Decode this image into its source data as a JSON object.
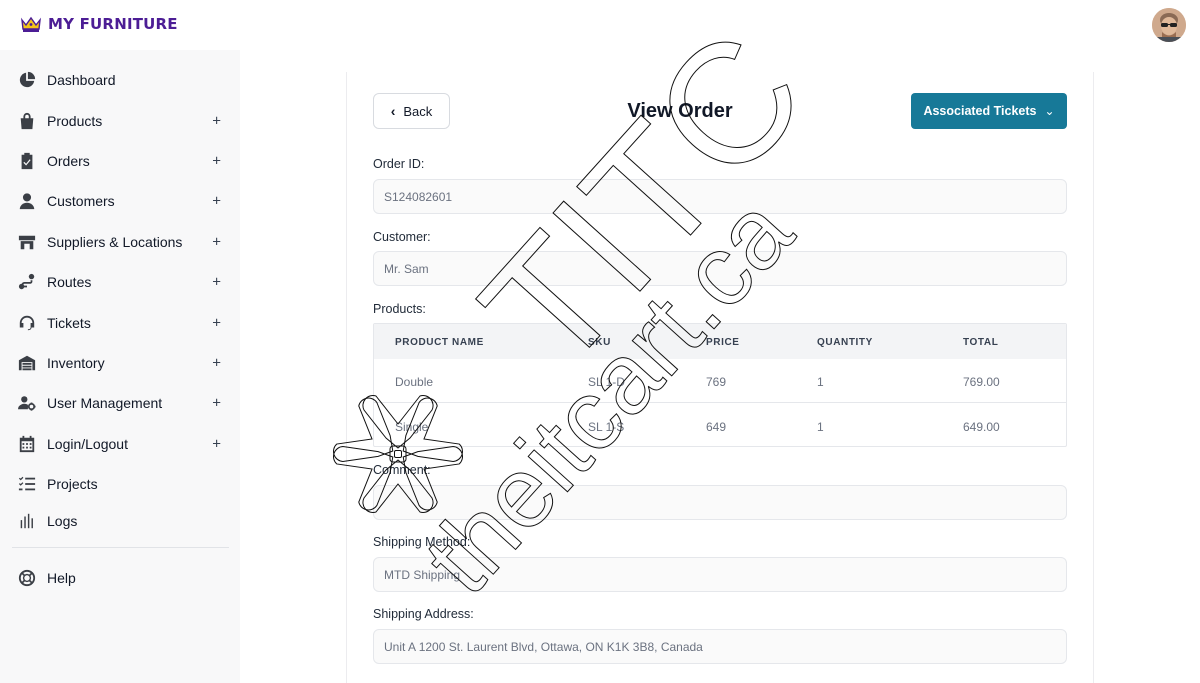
{
  "header": {
    "brand": "MY FURNITURE",
    "accent_color": "#4c1d95",
    "avatar": "user-avatar"
  },
  "sidebar": {
    "items": [
      {
        "label": "Dashboard",
        "icon": "pie-chart-icon",
        "expandable": false
      },
      {
        "label": "Products",
        "icon": "shopping-bag-icon",
        "expandable": true
      },
      {
        "label": "Orders",
        "icon": "clipboard-check-icon",
        "expandable": true
      },
      {
        "label": "Customers",
        "icon": "user-icon",
        "expandable": true
      },
      {
        "label": "Suppliers & Locations",
        "icon": "store-icon",
        "expandable": true
      },
      {
        "label": "Routes",
        "icon": "route-icon",
        "expandable": true
      },
      {
        "label": "Tickets",
        "icon": "headset-icon",
        "expandable": true
      },
      {
        "label": "Inventory",
        "icon": "warehouse-icon",
        "expandable": true
      },
      {
        "label": "User Management",
        "icon": "user-cog-icon",
        "expandable": true
      },
      {
        "label": "Login/Logout",
        "icon": "calendar-icon",
        "expandable": true
      },
      {
        "label": "Projects",
        "icon": "checklist-icon",
        "expandable": false
      },
      {
        "label": "Logs",
        "icon": "bar-chart-icon",
        "expandable": false
      }
    ],
    "plus": "+",
    "help_label": "Help",
    "help_icon": "lifebuoy-icon"
  },
  "main": {
    "title": "View Order",
    "back_label": "Back",
    "associated_label": "Associated Tickets",
    "button_color": "#177998",
    "fields": {
      "order_id_label": "Order ID:",
      "order_id_value": "S124082601",
      "customer_label": "Customer:",
      "customer_value": "Mr. Sam",
      "products_label": "Products:",
      "comment_label": "Comment:",
      "comment_value": "",
      "shipping_method_label": "Shipping Method:",
      "shipping_method_value": "MTD Shipping",
      "shipping_address_label": "Shipping Address:",
      "shipping_address_value": "Unit A  1200 St. Laurent Blvd, Ottawa, ON K1K 3B8, Canada"
    },
    "table": {
      "headers": [
        "PRODUCT NAME",
        "SKU",
        "PRICE",
        "QUANTITY",
        "TOTAL"
      ],
      "rows": [
        [
          "Double",
          "SL 1-D",
          "769",
          "1",
          "769.00"
        ],
        [
          "Single",
          "SL 1-S",
          "649",
          "1",
          "649.00"
        ]
      ]
    }
  },
  "watermark": {
    "text_large": "TITC",
    "text_diagonal": "theitcart.ca"
  }
}
